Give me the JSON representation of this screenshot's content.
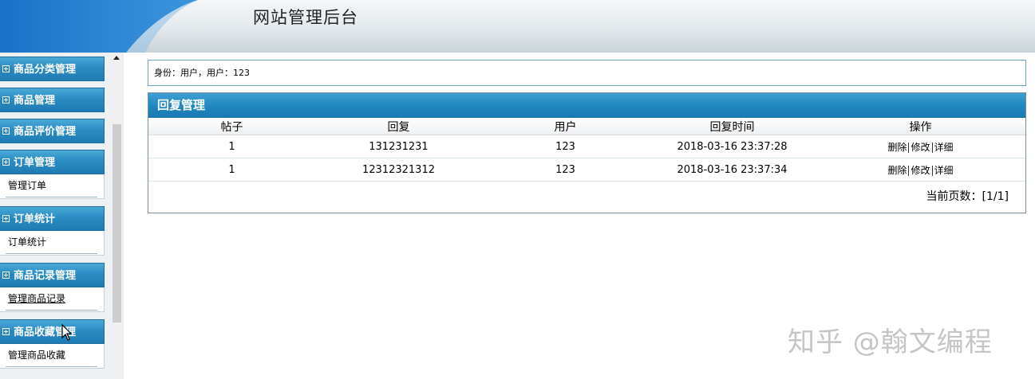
{
  "header": {
    "title": "网站管理后台"
  },
  "sidebar": {
    "groups": [
      {
        "label": "商品分类管理"
      },
      {
        "label": "商品管理"
      },
      {
        "label": "商品评价管理"
      },
      {
        "label": "订单管理",
        "sub": "管理订单"
      },
      {
        "label": "订单统计",
        "sub": "订单统计"
      },
      {
        "label": "商品记录管理",
        "sub": "管理商品记录"
      },
      {
        "label": "商品收藏管理",
        "sub": "管理商品收藏"
      }
    ]
  },
  "identity": {
    "text": "身份：用户，用户：123"
  },
  "panel": {
    "title": "回复管理",
    "columns": [
      "帖子",
      "回复",
      "用户",
      "回复时间",
      "操作"
    ],
    "rows": [
      {
        "post": "1",
        "reply": "131231231",
        "user": "123",
        "time": "2018-03-16 23:37:28"
      },
      {
        "post": "1",
        "reply": "12312321312",
        "user": "123",
        "time": "2018-03-16 23:37:34"
      }
    ],
    "actions": {
      "delete": "删除",
      "edit": "修改",
      "detail": "详细"
    },
    "pager": "当前页数：[1/1]"
  },
  "watermark": "知乎 @翰文编程",
  "colors": {
    "menu_head": "#2a8cc4",
    "panel_title": "#2188c1",
    "identity_border": "#6aa6c4"
  }
}
